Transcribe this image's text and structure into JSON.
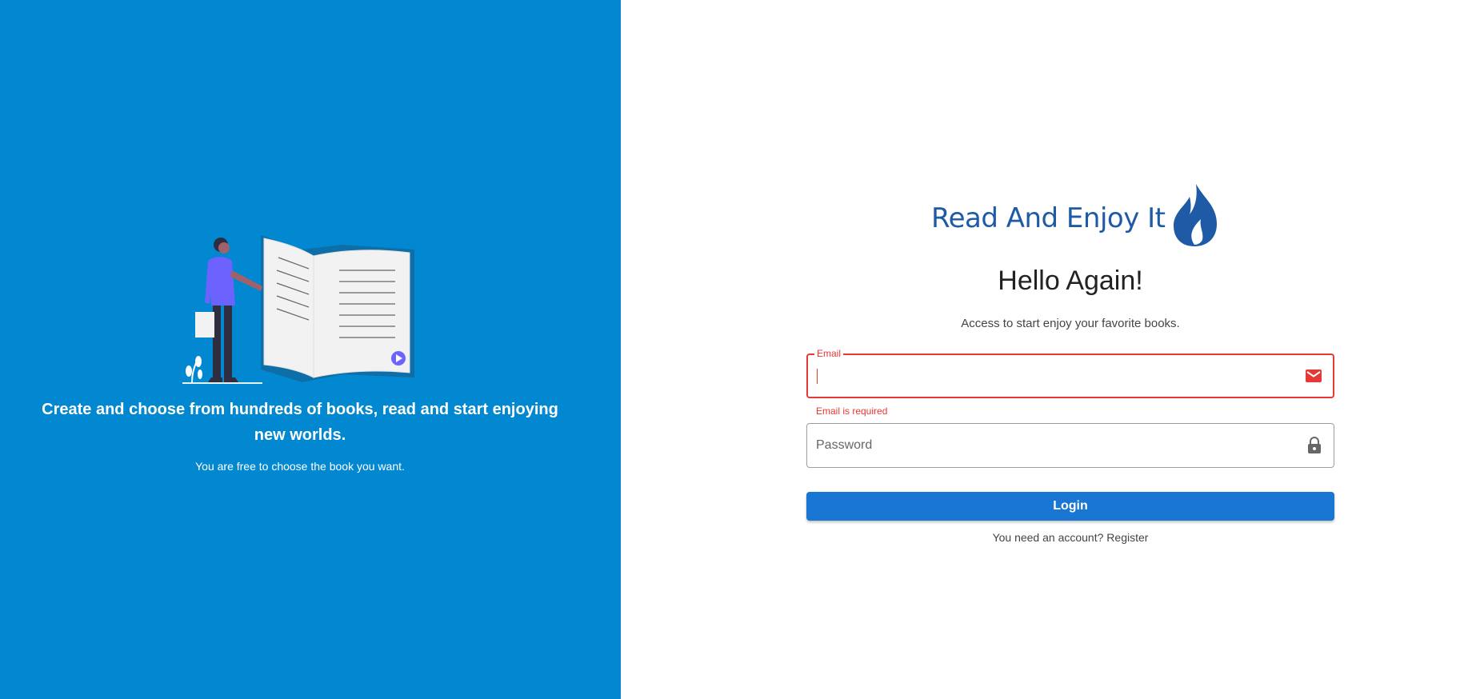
{
  "hero": {
    "title": "Create and choose from hundreds of books, read and start enjoying new worlds.",
    "subtitle": "You are free to choose the book you want.",
    "background_color": "#0288d1",
    "illustration_icon": "reading-person-illustration"
  },
  "brand": {
    "name": "Read And Enjoy It",
    "logo_icon": "flame-icon",
    "color": "#1e5aa5"
  },
  "form": {
    "heading": "Hello Again!",
    "subheading": "Access to start enjoy your favorite books.",
    "email": {
      "label": "Email",
      "value": "",
      "error": "Email is required",
      "icon": "mail-icon",
      "error_color": "#e53935"
    },
    "password": {
      "placeholder": "Password",
      "value": "",
      "icon": "lock-icon"
    },
    "login_label": "Login",
    "login_color": "#1976d2",
    "register_prompt": "You need an account?",
    "register_link": "Register"
  }
}
